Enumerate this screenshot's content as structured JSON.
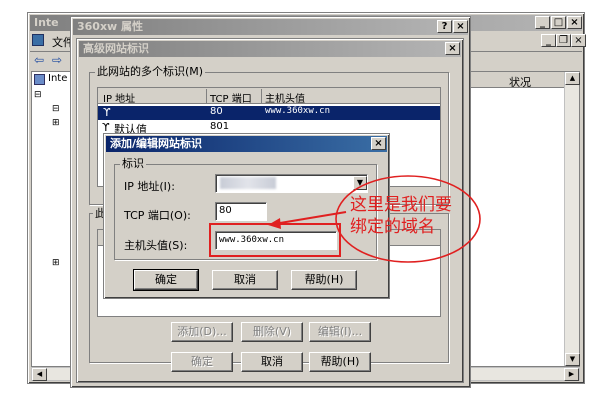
{
  "mmc": {
    "title": "Inte",
    "menu_file": "文件",
    "tree_root": "Inte",
    "column_status": "状况"
  },
  "props": {
    "title": "360xw 属性",
    "help_btn": "?",
    "close_btn": "×"
  },
  "adv": {
    "title": "高级网站标识",
    "group_label": "此网站的多个标识(M)",
    "col_ip": "IP 地址",
    "col_port": "TCP 端口",
    "col_host": "主机头值",
    "rows": [
      {
        "ip": "",
        "port": "80",
        "host": "www.360xw.cn"
      },
      {
        "ip": "默认值",
        "port": "801",
        "host": ""
      }
    ],
    "add": "添加(D)...",
    "remove": "删除(V)",
    "edit": "编辑(I)...",
    "partial_label": "此",
    "ok": "确定",
    "cancel": "取消",
    "help": "帮助(H)"
  },
  "edit_dialog": {
    "title": "添加/编辑网站标识",
    "group_label": "标识",
    "ip_label": "IP 地址(I):",
    "port_label": "TCP 端口(O):",
    "port_value": "80",
    "host_label": "主机头值(S):",
    "host_value": "www.360xw.cn",
    "ok": "确定",
    "cancel": "取消",
    "help": "帮助(H)"
  },
  "annotation": {
    "line1": "这里是我们要",
    "line2": "绑定的域名",
    "color": "#e02020"
  }
}
